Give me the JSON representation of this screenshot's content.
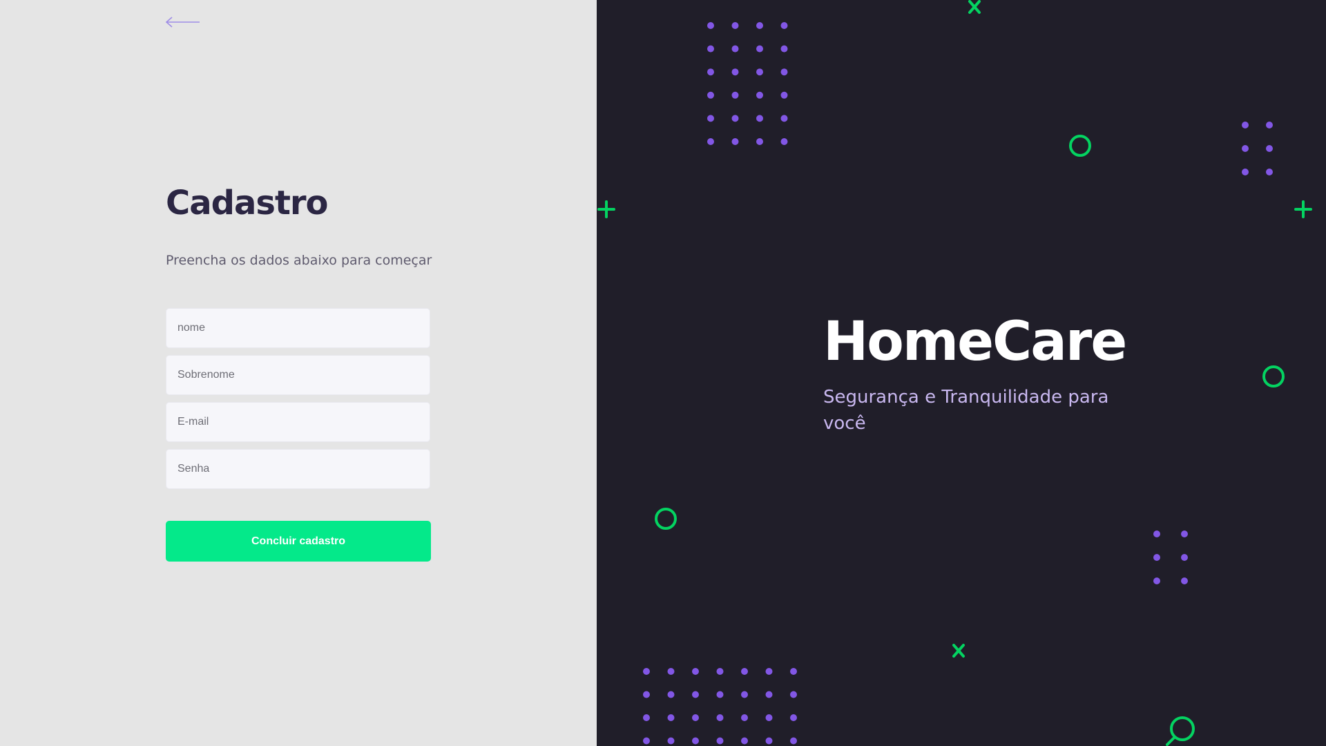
{
  "signup": {
    "title": "Cadastro",
    "subtitle": "Preencha os dados abaixo para começar",
    "fields": {
      "first_name": {
        "placeholder": "nome",
        "value": ""
      },
      "last_name": {
        "placeholder": "Sobrenome",
        "value": ""
      },
      "email": {
        "placeholder": "E-mail",
        "value": ""
      },
      "password": {
        "placeholder": "Senha",
        "value": ""
      }
    },
    "submit_label": "Concluir cadastro"
  },
  "hero": {
    "brand": "HomeCare",
    "tagline": "Segurança e Tranquilidade para você"
  },
  "icons": {
    "back": "arrow-left-icon",
    "decor": [
      "dot-grid",
      "circle-outline",
      "plus",
      "x-mark",
      "magnifier"
    ]
  },
  "colors": {
    "left_bg": "#e5e5e5",
    "right_bg": "#201e29",
    "title": "#2b2643",
    "accent_green": "#04e98a",
    "decor_green": "#04d361",
    "dot_purple": "#8257e5",
    "tagline": "#c9b8f0",
    "back_arrow": "#9f8de6"
  }
}
